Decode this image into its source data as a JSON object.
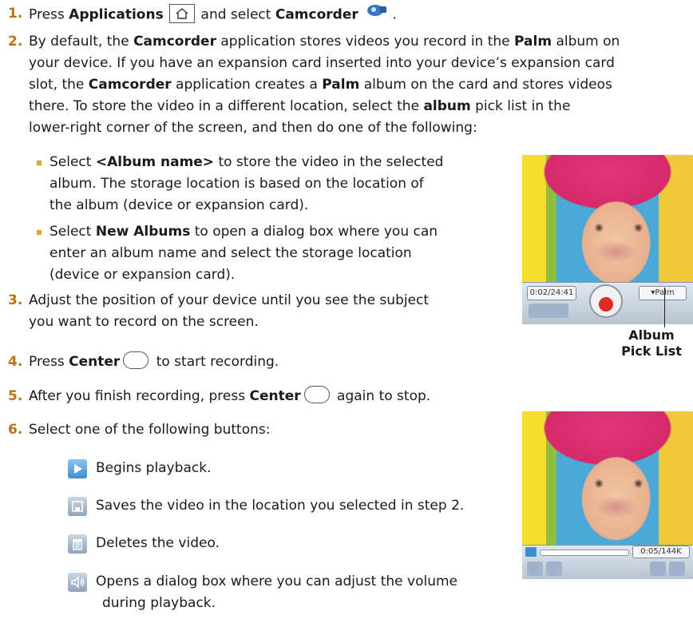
{
  "steps": [
    {
      "num": "1.",
      "pre": "Press ",
      "b1": "Applications",
      "mid": " and select ",
      "b2": "Camcorder",
      "post": " ."
    },
    {
      "num": "2.",
      "text_a": "By default, the ",
      "b_camcorder": "Camcorder",
      "text_b": " application stores videos you record in the ",
      "b_palm": "Palm",
      "text_c": " album on",
      "line2": "your device. If you have an expansion card inserted into your device’s expansion card",
      "line3_a": "slot, the ",
      "line3_b": " application creates a ",
      "line3_c": " album on the card and stores videos",
      "line4": "there. To store the video in a different location, select the ",
      "b_album": "album",
      "line4_b": " pick list in the",
      "line5": "lower-right corner of the screen, and then do one of the following:"
    },
    {
      "num": "3.",
      "line1": "Adjust the position of your device until you see the subject",
      "line2": "you want to record on the screen."
    },
    {
      "num": "4.",
      "pre": "Press ",
      "b": "Center",
      "post": " to start recording."
    },
    {
      "num": "5.",
      "pre": "After you finish recording, press ",
      "b": "Center",
      "post": " again to stop."
    },
    {
      "num": "6.",
      "text": "Select one of the following buttons:"
    }
  ],
  "bullets": [
    {
      "pre": "Select ",
      "b": "<Album name>",
      "l1": " to store the video in the selected",
      "l2": "album. The storage location is based on the location of",
      "l3": "the album (device or expansion card)."
    },
    {
      "pre": "Select ",
      "b": "New Albums",
      "l1": " to open a dialog box where you can",
      "l2": "enter an album name and select the storage location",
      "l3": "(device or expansion card)."
    }
  ],
  "buttons": [
    {
      "icon": "play-icon",
      "label": "Begins playback."
    },
    {
      "icon": "save-icon",
      "label": "Saves the video in the location you selected in step 2."
    },
    {
      "icon": "trash-icon",
      "label": "Deletes the video."
    },
    {
      "icon": "speaker-icon",
      "label_1": "Opens a dialog box where you can adjust the volume",
      "label_2": "during playback."
    }
  ],
  "screen1": {
    "time": "0:02/24:41",
    "album": "▾Palm"
  },
  "screen2": {
    "counter": "0:05/144K"
  },
  "callout": {
    "line1": "Album",
    "line2": "Pick List"
  },
  "colors": {
    "step_number": "#b8740e",
    "bullet": "#e0a52a",
    "accent_blue": "#3a8fd0"
  }
}
